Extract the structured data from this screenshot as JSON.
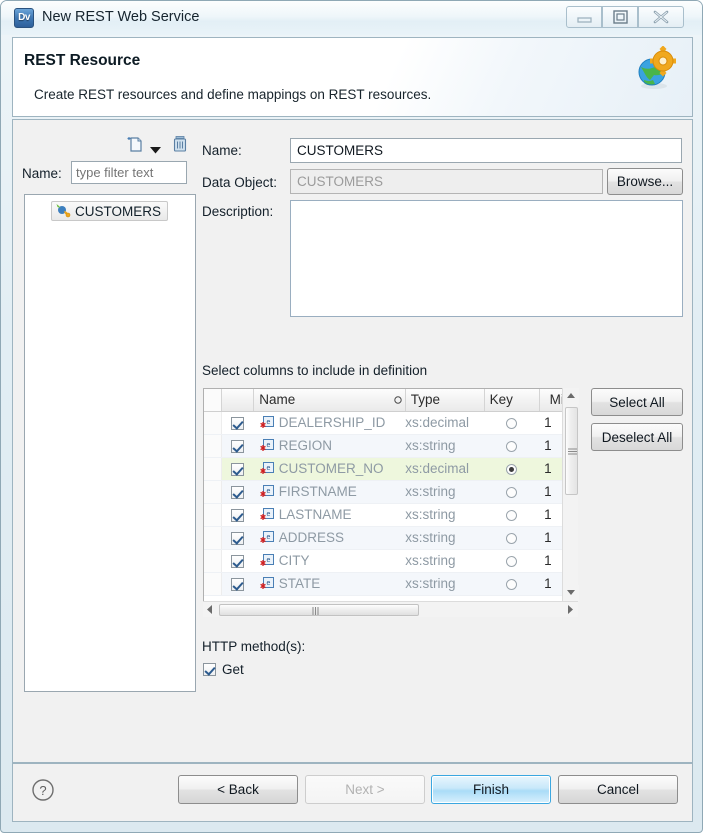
{
  "window": {
    "title": "New REST Web Service",
    "app_icon": "Dv",
    "controls": {
      "minimize": "minimize-icon",
      "maximize": "maximize-icon",
      "close": "close-icon"
    }
  },
  "header": {
    "title": "REST Resource",
    "description": "Create REST resources and define mappings on REST resources.",
    "icon": "globe-gear-icon"
  },
  "tree_panel": {
    "toolbar": {
      "new_icon": "new-document-icon",
      "dropdown_icon": "chevron-down-icon",
      "delete_icon": "trash-icon"
    },
    "filter_label": "Name:",
    "filter_placeholder": "type filter text",
    "filter_value": "",
    "items": [
      {
        "label": "CUSTOMERS",
        "icon": "rest-resource-icon",
        "selected": true
      }
    ]
  },
  "form": {
    "name_label": "Name:",
    "name_value": "CUSTOMERS",
    "data_object_label": "Data Object:",
    "data_object_value": "CUSTOMERS",
    "browse_label": "Browse...",
    "description_label": "Description:",
    "description_value": ""
  },
  "columns_section": {
    "title": "Select columns to include in definition",
    "headers": [
      "",
      "",
      "Name",
      "Type",
      "Key",
      "Mi."
    ],
    "sort_indicator": "circle-sort-icon",
    "rows": [
      {
        "checked": true,
        "name": "DEALERSHIP_ID",
        "type": "xs:decimal",
        "key": false,
        "min": "1",
        "selected": false
      },
      {
        "checked": true,
        "name": "REGION",
        "type": "xs:string",
        "key": false,
        "min": "1",
        "selected": false
      },
      {
        "checked": true,
        "name": "CUSTOMER_NO",
        "type": "xs:decimal",
        "key": true,
        "min": "1",
        "selected": true
      },
      {
        "checked": true,
        "name": "FIRSTNAME",
        "type": "xs:string",
        "key": false,
        "min": "1",
        "selected": false
      },
      {
        "checked": true,
        "name": "LASTNAME",
        "type": "xs:string",
        "key": false,
        "min": "1",
        "selected": false
      },
      {
        "checked": true,
        "name": "ADDRESS",
        "type": "xs:string",
        "key": false,
        "min": "1",
        "selected": false
      },
      {
        "checked": true,
        "name": "CITY",
        "type": "xs:string",
        "key": false,
        "min": "1",
        "selected": false
      },
      {
        "checked": true,
        "name": "STATE",
        "type": "xs:string",
        "key": false,
        "min": "1",
        "selected": false
      }
    ],
    "select_all_label": "Select All",
    "deselect_all_label": "Deselect All",
    "row_icon": "element-required-icon"
  },
  "http_methods": {
    "label": "HTTP method(s):",
    "options": [
      {
        "label": "Get",
        "checked": true
      }
    ]
  },
  "footer": {
    "help_icon": "help-icon",
    "back_label": "< Back",
    "next_label": "Next >",
    "finish_label": "Finish",
    "cancel_label": "Cancel"
  },
  "colors": {
    "accent": "#3ba7e0",
    "selected_row": "#eef7dd",
    "alt_row": "#f4f7fb",
    "disabled_text": "#b2b2b2"
  }
}
